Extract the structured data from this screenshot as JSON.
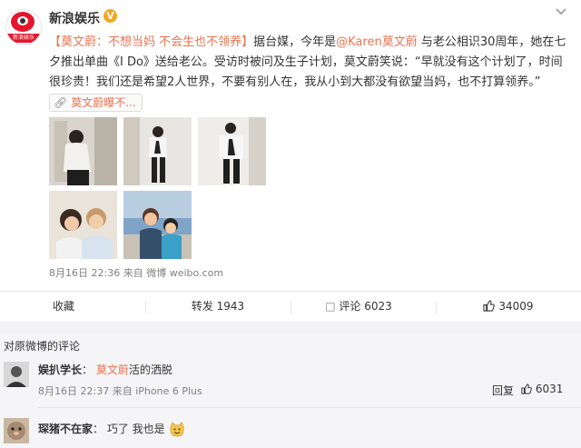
{
  "post": {
    "username": "新浪娱乐",
    "verified_badge": "V",
    "avatar_label": "新浪娱乐",
    "topic": "【莫文蔚：不想当妈 不会生也不领养】",
    "text_1": "据台媒，今年是",
    "mention": "@Karen莫文蔚",
    "text_2": " 与老公相识30周年，她在七夕推出单曲《I Do》送给老公。受访时被问及生子计划，莫文蔚笑说：“早就没有这个计划了，时间很珍贵！我们还是希望2人世界，不要有别人在，我从小到大都没有欲望当妈，也不打算领养。”",
    "link_chip": "莫文蔚曝不...",
    "timestamp": "8月16日 22:36",
    "source_prefix": "来自",
    "source": "微博 weibo.com",
    "more_icon": "chevron-down-icon",
    "images": [
      {
        "name": "photo-1",
        "desc_icon": "photo"
      },
      {
        "name": "photo-2",
        "desc_icon": "photo"
      },
      {
        "name": "photo-3",
        "desc_icon": "photo"
      },
      {
        "name": "photo-4",
        "desc_icon": "photo"
      },
      {
        "name": "photo-5",
        "desc_icon": "photo"
      }
    ]
  },
  "actions": {
    "favorite": "收藏",
    "repost": "转发 1943",
    "comment": "评论 6023",
    "like": "34009"
  },
  "comments_section": {
    "header": "对原微博的评论",
    "comments": [
      {
        "name": "娱扒学长",
        "separator": "：",
        "mention": "莫文蔚",
        "text": "活的洒脱",
        "time": "8月16日 22:37",
        "source_prefix": "来自",
        "source": "iPhone 6 Plus",
        "reply": "回复",
        "likes": "6031"
      },
      {
        "name": "琛猪不在家",
        "separator": "：",
        "text": "巧了 我也是"
      }
    ]
  },
  "colors": {
    "accent": "#eb7350",
    "brand_red": "#e6162d",
    "verified": "#f5a623"
  }
}
